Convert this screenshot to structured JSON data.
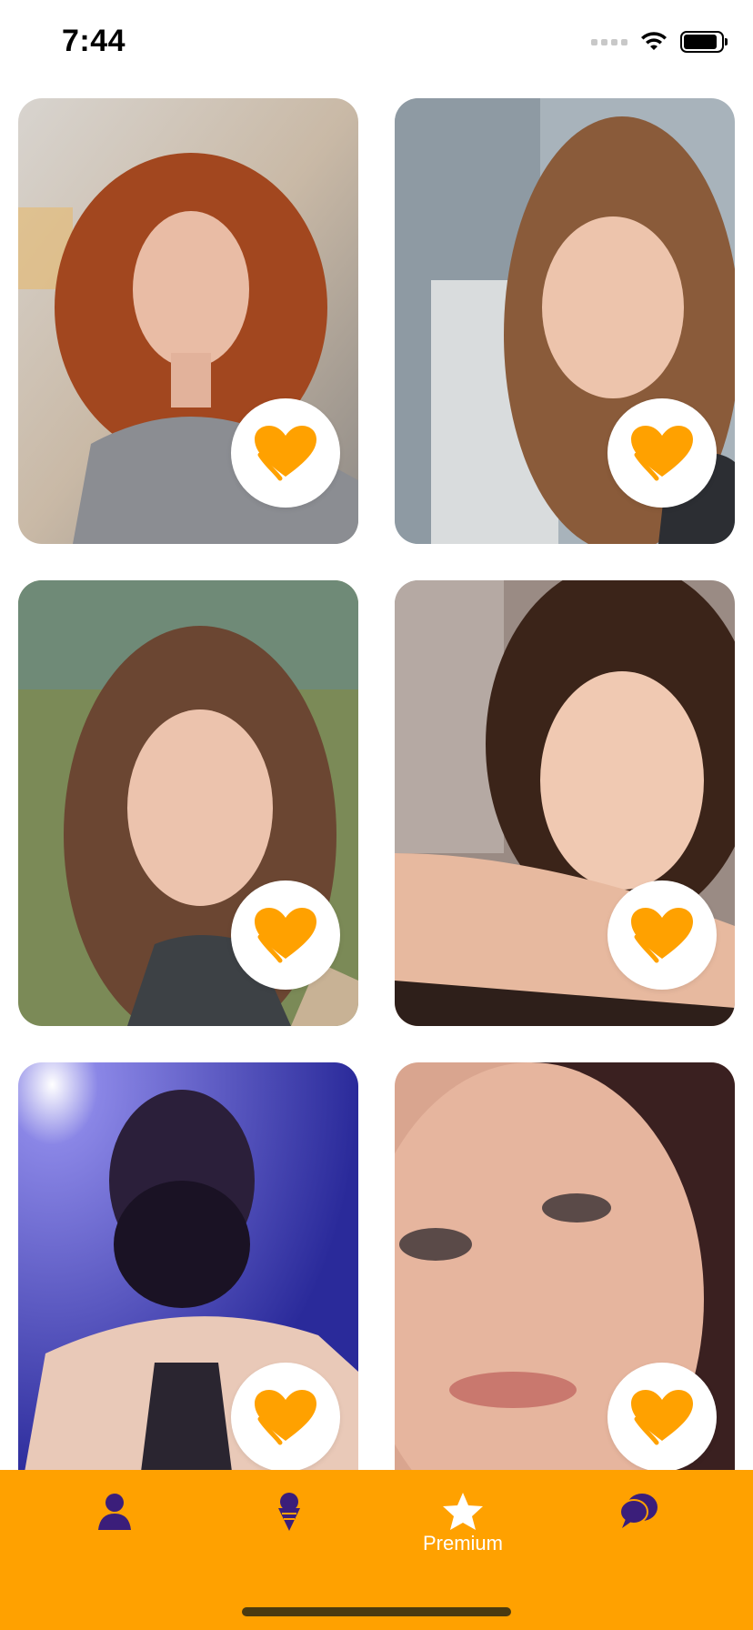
{
  "status_bar": {
    "time": "7:44"
  },
  "cards": [
    {
      "icon": "heart-icon"
    },
    {
      "icon": "heart-icon"
    },
    {
      "icon": "heart-icon"
    },
    {
      "icon": "heart-icon"
    },
    {
      "icon": "heart-icon"
    },
    {
      "icon": "heart-icon"
    }
  ],
  "tab_bar": {
    "tabs": [
      {
        "icon": "person-icon"
      },
      {
        "icon": "ice-cream-icon"
      },
      {
        "icon": "star-icon",
        "label": "Premium"
      },
      {
        "icon": "chat-bubbles-icon"
      }
    ]
  },
  "colors": {
    "accent": "#ffa100",
    "tab_icon": "#3b1e7a",
    "heart": "#ffa100"
  }
}
